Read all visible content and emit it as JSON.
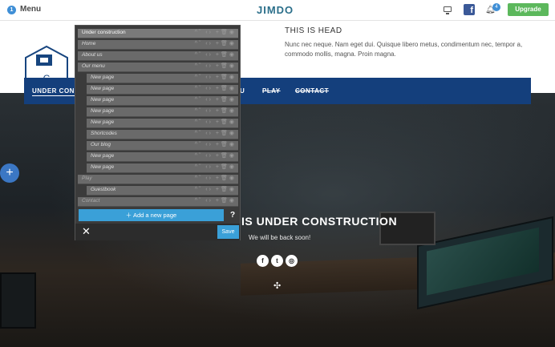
{
  "topbar": {
    "menu_badge": "1",
    "menu_label": "Menu",
    "logo": "JIMDO",
    "facebook_letter": "f",
    "notification_count": "4",
    "upgrade_label": "Upgrade"
  },
  "header": {
    "logo_letter": "C",
    "title": "THIS IS HEAD",
    "text": "Nunc nec neque. Nam eget dui. Quisque libero metus, condimentum nec, tempor a, commodo mollis, magna. Proin magna."
  },
  "nav": {
    "items": [
      {
        "label": "UNDER CONST"
      },
      {
        "label": "U"
      },
      {
        "label": "PLAY"
      },
      {
        "label": "CONTACT"
      }
    ]
  },
  "hero": {
    "title": "IS UNDER CONSTRUCTION",
    "subtitle": "We will be back soon!",
    "social": [
      "f",
      "t",
      "◎"
    ]
  },
  "editor": {
    "rows": [
      {
        "label": "Under construction"
      },
      {
        "label": "Home"
      },
      {
        "label": "About us"
      },
      {
        "label": "Our menu"
      },
      {
        "label": "New page"
      },
      {
        "label": "New page"
      },
      {
        "label": "New page"
      },
      {
        "label": "New page"
      },
      {
        "label": "New page"
      },
      {
        "label": "Shortcodes"
      },
      {
        "label": "Our blog"
      },
      {
        "label": "New page"
      },
      {
        "label": "New page"
      },
      {
        "label": "Play"
      },
      {
        "label": "Guestbook"
      },
      {
        "label": "Contact"
      }
    ],
    "add_page_label": "Add a new page",
    "help_label": "?",
    "close_label": "✕",
    "save_label": "Save"
  }
}
